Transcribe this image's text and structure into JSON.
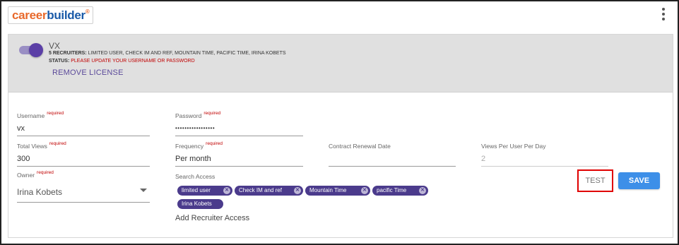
{
  "header": {
    "logo_part1": "career",
    "logo_part2": "builder",
    "logo_mark": "®",
    "menu_icon": "more-vertical-icon"
  },
  "license": {
    "title": "VX",
    "recruiters_label": "5 RECRUITERS:",
    "recruiters_value": " LIMITED USER, CHECK IM AND REF, MOUNTAIN TIME, PACIFIC TIME, IRINA KOBETS",
    "status_label": "STATUS:",
    "status_value": " PLEASE UPDATE YOUR USERNAME OR PASSWORD",
    "remove_label": "REMOVE LICENSE",
    "toggle_on": true
  },
  "form": {
    "username": {
      "label": "Username",
      "required": "required",
      "value": "vx"
    },
    "password": {
      "label": "Password",
      "required": "required",
      "value": "•••••••••••••••••"
    },
    "total_views": {
      "label": "Total Views",
      "required": "required",
      "value": "300"
    },
    "frequency": {
      "label": "Frequency",
      "required": "required",
      "value": "Per month"
    },
    "contract_renewal": {
      "label": "Contract Renewal Date",
      "value": ""
    },
    "views_per_user": {
      "label": "Views Per User Per Day",
      "value": "2"
    },
    "owner": {
      "label": "Owner",
      "required": "required",
      "value": "Irina Kobets"
    },
    "search_access": {
      "label": "Search Access",
      "chips": [
        "limited user",
        "Check IM and ref",
        "Mountain Time",
        "pacific Time",
        "Irina Kobets"
      ],
      "chip_remove_glyph": "✕",
      "add_label": "Add Recruiter Access"
    }
  },
  "actions": {
    "test_label": "TEST",
    "save_label": "SAVE"
  },
  "colors": {
    "accent_purple": "#4b3b8c",
    "save_blue": "#3d8fe8",
    "required_red": "#c00000",
    "highlight_red": "#e00000"
  }
}
